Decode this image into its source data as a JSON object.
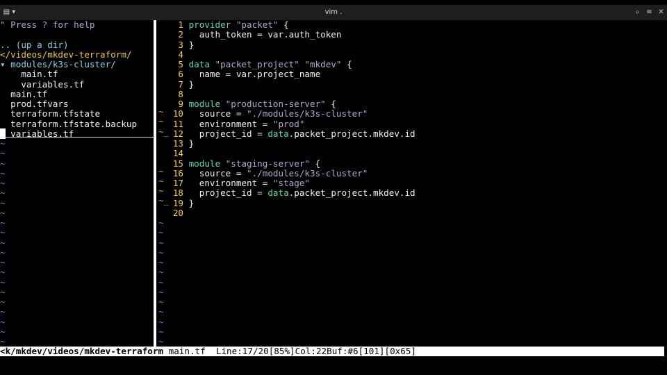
{
  "window": {
    "title": "vim .",
    "menu_icon": "terminal-menu-icon",
    "search_icon": "search-icon",
    "hamburger_icon": "hamburger-icon",
    "close_icon": "close-icon"
  },
  "tree": {
    "help": "\" Press ? for help",
    "up": ".. (up a dir)",
    "path": "</videos/mkdev-terraform/",
    "items": [
      {
        "text": "▾ modules/k3s-cluster/",
        "kind": "sub"
      },
      {
        "text": "    main.tf",
        "kind": "file"
      },
      {
        "text": "    variables.tf",
        "kind": "file"
      },
      {
        "text": "  main.tf",
        "kind": "file"
      },
      {
        "text": "  prod.tfvars",
        "kind": "file"
      },
      {
        "text": "  terraform.tfstate",
        "kind": "file"
      },
      {
        "text": "  terraform.tfstate.backup",
        "kind": "file"
      },
      {
        "text": "variables.tf",
        "kind": "file"
      }
    ]
  },
  "code": {
    "lines": [
      {
        "n": "1",
        "parts": [
          [
            "kw",
            "provider "
          ],
          [
            "str",
            "\"packet\""
          ],
          [
            "txt",
            " {"
          ]
        ]
      },
      {
        "n": "2",
        "parts": [
          [
            "txt",
            "  auth_token = var.auth_token"
          ]
        ]
      },
      {
        "n": "3",
        "parts": [
          [
            "txt",
            "}"
          ]
        ]
      },
      {
        "n": "4",
        "parts": []
      },
      {
        "n": "5",
        "parts": [
          [
            "kw",
            "data "
          ],
          [
            "str",
            "\"packet_project\" \"mkdev\""
          ],
          [
            "txt",
            " {"
          ]
        ]
      },
      {
        "n": "6",
        "parts": [
          [
            "txt",
            "  name = var.project_name"
          ]
        ]
      },
      {
        "n": "7",
        "parts": [
          [
            "txt",
            "}"
          ]
        ]
      },
      {
        "n": "8",
        "parts": []
      },
      {
        "n": "9",
        "mark": "~",
        "parts": [
          [
            "kw",
            "module "
          ],
          [
            "str",
            "\"production-server\""
          ],
          [
            "txt",
            " {"
          ]
        ]
      },
      {
        "n": "10",
        "mark": "~",
        "parts": [
          [
            "txt",
            "  source = "
          ],
          [
            "str",
            "\"./modules/k3s-cluster\""
          ]
        ]
      },
      {
        "n": "11",
        "mark": "~_",
        "parts": [
          [
            "txt",
            "  environment = "
          ],
          [
            "str",
            "\"prod\""
          ]
        ]
      },
      {
        "n": "12",
        "parts": [
          [
            "txt",
            "  project_id = "
          ],
          [
            "kw",
            "data"
          ],
          [
            "txt",
            ".packet_project.mkdev.id"
          ]
        ]
      },
      {
        "n": "13",
        "parts": [
          [
            "txt",
            "}"
          ]
        ]
      },
      {
        "n": "14",
        "parts": []
      },
      {
        "n": "15",
        "mark": "~",
        "parts": [
          [
            "kw",
            "module "
          ],
          [
            "str",
            "\"staging-server\""
          ],
          [
            "txt",
            " {"
          ]
        ]
      },
      {
        "n": "16",
        "mark": "~",
        "parts": [
          [
            "txt",
            "  source = "
          ],
          [
            "str",
            "\"./modules/k3s-cluster\""
          ]
        ]
      },
      {
        "n": "17",
        "mark": "~",
        "parts": [
          [
            "txt",
            "  environment = "
          ],
          [
            "str",
            "\"stage\""
          ]
        ]
      },
      {
        "n": "18",
        "mark": "~_",
        "parts": [
          [
            "txt",
            "  project_id = "
          ],
          [
            "kw",
            "data"
          ],
          [
            "txt",
            ".packet_project.mkdev.id"
          ]
        ]
      },
      {
        "n": "19",
        "parts": [
          [
            "txt",
            "}"
          ]
        ]
      },
      {
        "n": "20",
        "parts": []
      }
    ]
  },
  "status": {
    "path": "<k/mkdev/videos/mkdev-terraform",
    "file": " main.tf",
    "info": "  Line:17/20[85%]Col:22Buf:#6[101][0x65]"
  },
  "colors": {
    "keyword": "#5fd7af",
    "string": "#b6a4cf",
    "line_number": "#f6d043",
    "tilde": "#5f86c4"
  }
}
